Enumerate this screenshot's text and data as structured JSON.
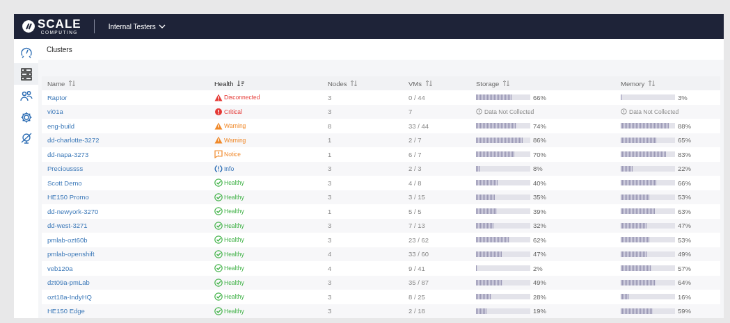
{
  "header": {
    "logo": {
      "name": "SCALE",
      "tagline": "COMPUTING"
    },
    "org_menu": {
      "label": "Internal Testers"
    }
  },
  "sidebar": {
    "items": [
      {
        "kind": "dashboard",
        "selected": false
      },
      {
        "kind": "clusters",
        "selected": true
      },
      {
        "kind": "users",
        "selected": false
      },
      {
        "kind": "settings",
        "selected": false
      },
      {
        "kind": "network",
        "selected": false
      }
    ]
  },
  "page": {
    "title": "Clusters"
  },
  "table": {
    "columns": [
      {
        "label": "Name",
        "sorted": false
      },
      {
        "label": "Health",
        "sorted": true
      },
      {
        "label": "Nodes",
        "sorted": false
      },
      {
        "label": "VMs",
        "sorted": false
      },
      {
        "label": "Storage",
        "sorted": false
      },
      {
        "label": "Memory",
        "sorted": false
      }
    ],
    "rows": [
      {
        "name": "Raptor",
        "health": {
          "kind": "disconnected",
          "label": "Disconnected"
        },
        "nodes": "3",
        "vms": "0 / 44",
        "storage": {
          "kind": "bar",
          "level": 0.66,
          "reading": "66%"
        },
        "memory": {
          "kind": "bar",
          "level": 0.03,
          "reading": "3%"
        }
      },
      {
        "name": "vi01a",
        "health": {
          "kind": "critical",
          "label": "Critical"
        },
        "nodes": "3",
        "vms": "7",
        "storage": {
          "kind": "note",
          "text": "Data Not Collected"
        },
        "memory": {
          "kind": "note",
          "text": "Data Not Collected"
        }
      },
      {
        "name": "eng-build",
        "health": {
          "kind": "warning",
          "label": "Warning"
        },
        "nodes": "8",
        "vms": "33 / 44",
        "storage": {
          "kind": "bar",
          "level": 0.74,
          "reading": "74%"
        },
        "memory": {
          "kind": "bar",
          "level": 0.88,
          "reading": "88%"
        }
      },
      {
        "name": "dd-charlotte-3272",
        "health": {
          "kind": "warning",
          "label": "Warning"
        },
        "nodes": "1",
        "vms": "2 / 7",
        "storage": {
          "kind": "bar",
          "level": 0.86,
          "reading": "86%"
        },
        "memory": {
          "kind": "bar",
          "level": 0.65,
          "reading": "65%"
        }
      },
      {
        "name": "dd-napa-3273",
        "health": {
          "kind": "notice",
          "label": "Notice"
        },
        "nodes": "1",
        "vms": "6 / 7",
        "storage": {
          "kind": "bar",
          "level": 0.7,
          "reading": "70%"
        },
        "memory": {
          "kind": "bar",
          "level": 0.83,
          "reading": "83%"
        }
      },
      {
        "name": "Precioussss",
        "health": {
          "kind": "info",
          "label": "Info"
        },
        "nodes": "3",
        "vms": "2 / 3",
        "storage": {
          "kind": "bar",
          "level": 0.08,
          "reading": "8%"
        },
        "memory": {
          "kind": "bar",
          "level": 0.22,
          "reading": "22%"
        }
      },
      {
        "name": "Scott Demo",
        "health": {
          "kind": "healthy",
          "label": "Healthy"
        },
        "nodes": "3",
        "vms": "4 / 8",
        "storage": {
          "kind": "bar",
          "level": 0.4,
          "reading": "40%"
        },
        "memory": {
          "kind": "bar",
          "level": 0.66,
          "reading": "66%"
        }
      },
      {
        "name": "HE150 Promo",
        "health": {
          "kind": "healthy",
          "label": "Healthy"
        },
        "nodes": "3",
        "vms": "3 / 15",
        "storage": {
          "kind": "bar",
          "level": 0.35,
          "reading": "35%"
        },
        "memory": {
          "kind": "bar",
          "level": 0.53,
          "reading": "53%"
        }
      },
      {
        "name": "dd-newyork-3270",
        "health": {
          "kind": "healthy",
          "label": "Healthy"
        },
        "nodes": "1",
        "vms": "5 / 5",
        "storage": {
          "kind": "bar",
          "level": 0.39,
          "reading": "39%"
        },
        "memory": {
          "kind": "bar",
          "level": 0.63,
          "reading": "63%"
        }
      },
      {
        "name": "dd-west-3271",
        "health": {
          "kind": "healthy",
          "label": "Healthy"
        },
        "nodes": "3",
        "vms": "7 / 13",
        "storage": {
          "kind": "bar",
          "level": 0.32,
          "reading": "32%"
        },
        "memory": {
          "kind": "bar",
          "level": 0.47,
          "reading": "47%"
        }
      },
      {
        "name": "pmlab-ozt60b",
        "health": {
          "kind": "healthy",
          "label": "Healthy"
        },
        "nodes": "3",
        "vms": "23 / 62",
        "storage": {
          "kind": "bar",
          "level": 0.62,
          "reading": "62%"
        },
        "memory": {
          "kind": "bar",
          "level": 0.53,
          "reading": "53%"
        }
      },
      {
        "name": "pmlab-openshift",
        "health": {
          "kind": "healthy",
          "label": "Healthy"
        },
        "nodes": "4",
        "vms": "33 / 60",
        "storage": {
          "kind": "bar",
          "level": 0.47,
          "reading": "47%"
        },
        "memory": {
          "kind": "bar",
          "level": 0.49,
          "reading": "49%"
        }
      },
      {
        "name": "veb120a",
        "health": {
          "kind": "healthy",
          "label": "Healthy"
        },
        "nodes": "4",
        "vms": "9 / 41",
        "storage": {
          "kind": "bar",
          "level": 0.02,
          "reading": "2%"
        },
        "memory": {
          "kind": "bar",
          "level": 0.57,
          "reading": "57%"
        }
      },
      {
        "name": "dzt09a-pmLab",
        "health": {
          "kind": "healthy",
          "label": "Healthy"
        },
        "nodes": "3",
        "vms": "35 / 87",
        "storage": {
          "kind": "bar",
          "level": 0.49,
          "reading": "49%"
        },
        "memory": {
          "kind": "bar",
          "level": 0.64,
          "reading": "64%"
        }
      },
      {
        "name": "ozt18a-IndyHQ",
        "health": {
          "kind": "healthy",
          "label": "Healthy"
        },
        "nodes": "3",
        "vms": "8 / 25",
        "storage": {
          "kind": "bar",
          "level": 0.28,
          "reading": "28%"
        },
        "memory": {
          "kind": "bar",
          "level": 0.16,
          "reading": "16%"
        }
      },
      {
        "name": "HE150 Edge",
        "health": {
          "kind": "healthy",
          "label": "Healthy"
        },
        "nodes": "3",
        "vms": "2 / 18",
        "storage": {
          "kind": "bar",
          "level": 0.19,
          "reading": "19%"
        },
        "memory": {
          "kind": "bar",
          "level": 0.59,
          "reading": "59%"
        }
      }
    ]
  }
}
